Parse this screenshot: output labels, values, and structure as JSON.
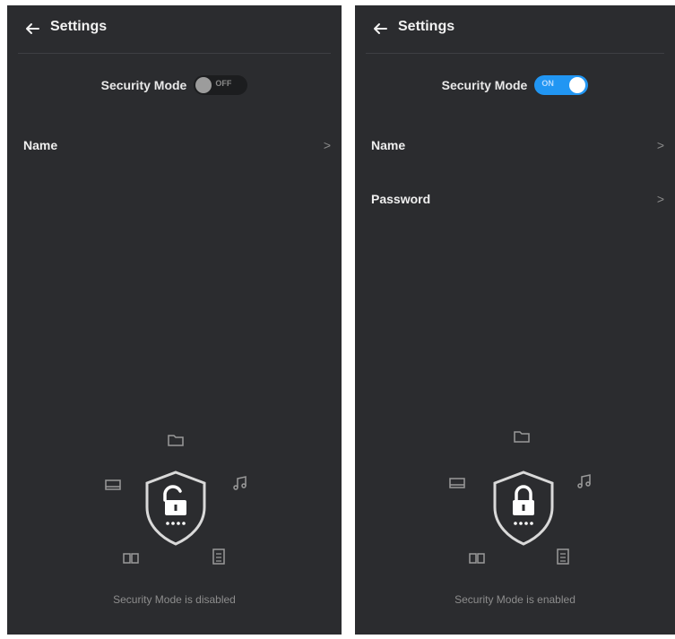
{
  "screens": [
    {
      "header_title": "Settings",
      "security_mode_label": "Security Mode",
      "toggle_state": "OFF",
      "items": [
        {
          "label": "Name"
        }
      ],
      "status_text": "Security Mode is disabled",
      "lock_state": "unlocked"
    },
    {
      "header_title": "Settings",
      "security_mode_label": "Security Mode",
      "toggle_state": "ON",
      "items": [
        {
          "label": "Name"
        },
        {
          "label": "Password"
        }
      ],
      "status_text": "Security Mode is enabled",
      "lock_state": "locked"
    }
  ],
  "icons": [
    "back-arrow-icon",
    "chevron-right-icon",
    "folder-icon",
    "photo-icon",
    "music-note-icon",
    "video-icon",
    "document-icon",
    "shield-lock-icon"
  ],
  "colors": {
    "background": "#2b2c2f",
    "toggle_on": "#2196f3",
    "toggle_off": "#1c1d1f",
    "text": "#efefef",
    "muted_text": "#8d8d8d"
  }
}
